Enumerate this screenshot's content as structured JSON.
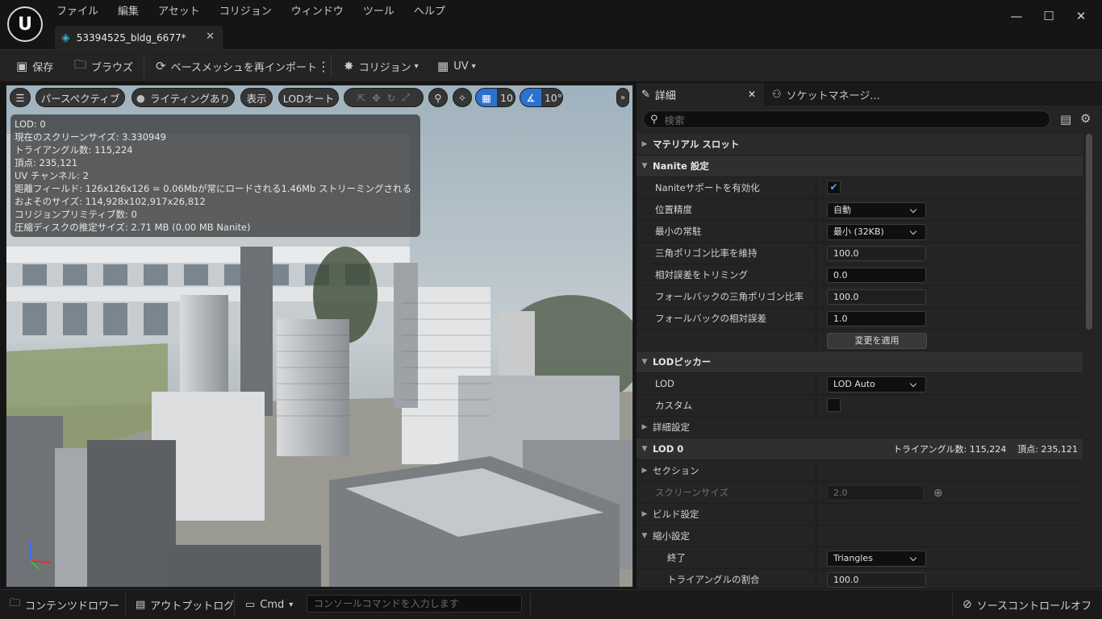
{
  "app": {
    "logo_text": "U",
    "close_symbol": "✕"
  },
  "menu": [
    "ファイル",
    "編集",
    "アセット",
    "コリジョン",
    "ウィンドウ",
    "ツール",
    "ヘルプ"
  ],
  "asset_tab": {
    "name": "53394525_bldg_6677*"
  },
  "toolbar": {
    "save": "保存",
    "browse": "ブラウズ",
    "reimport": "ベースメッシュを再インポート",
    "collision": "コリジョン",
    "uv": "UV"
  },
  "viewport": {
    "perspective": "パースペクティブ",
    "lighting": "ライティングあり",
    "show": "表示",
    "lod": "LODオート",
    "grid_snap": "10",
    "rot_snap": "10°",
    "stats": [
      "LOD: 0",
      "現在のスクリーンサイズ: 3.330949",
      "トライアングル数: 115,224",
      "頂点: 235,121",
      "UV チャンネル: 2",
      "距離フィールド: 126x126x126 = 0.06Mbが常にロードされる1.46Mb ストリーミングされる",
      "およそのサイズ: 114,928x102,917x26,812",
      "コリジョンプリミティブ数: 0",
      "圧縮ディスクの推定サイズ: 2.71 MB (0.00 MB Nanite)"
    ]
  },
  "panel": {
    "tab_details": "詳細",
    "tab_socket": "ソケットマネージ...",
    "search_placeholder": "検索",
    "material_slots": "マテリアル スロット",
    "nanite_settings": "Nanite 設定",
    "nanite_enable": "Naniteサポートを有効化",
    "position_precision": "位置精度",
    "position_precision_value": "自動",
    "min_resident": "最小の常駐",
    "min_resident_value": "最小 (32KB)",
    "keep_triangle": "三角ポリゴン比率を維持",
    "keep_triangle_value": "100.0",
    "trim_relative": "相対誤差をトリミング",
    "trim_relative_value": "0.0",
    "fallback_triangle": "フォールバックの三角ポリゴン比率",
    "fallback_triangle_value": "100.0",
    "fallback_relative": "フォールバックの相対誤差",
    "fallback_relative_value": "1.0",
    "apply_changes": "変更を適用",
    "lod_picker": "LODピッカー",
    "lod_label": "LOD",
    "lod_value": "LOD Auto",
    "custom": "カスタム",
    "advanced": "詳細設定",
    "lod0": "LOD 0",
    "lod0_stats": "トライアングル数: 115,224    頂点: 235,121",
    "section": "セクション",
    "screen_size": "スクリーンサイズ",
    "screen_size_value": "2.0",
    "build_settings": "ビルド設定",
    "reduction_settings": "縮小設定",
    "termination": "終了",
    "termination_value": "Triangles",
    "triangle_percent": "トライアングルの割合",
    "triangle_percent_value": "100.0"
  },
  "status": {
    "content_drawer": "コンテンツドロワー",
    "output_log": "アウトプットログ",
    "cmd": "Cmd",
    "console_placeholder": "コンソールコマンドを入力します",
    "source_control": "ソースコントロールオフ"
  }
}
